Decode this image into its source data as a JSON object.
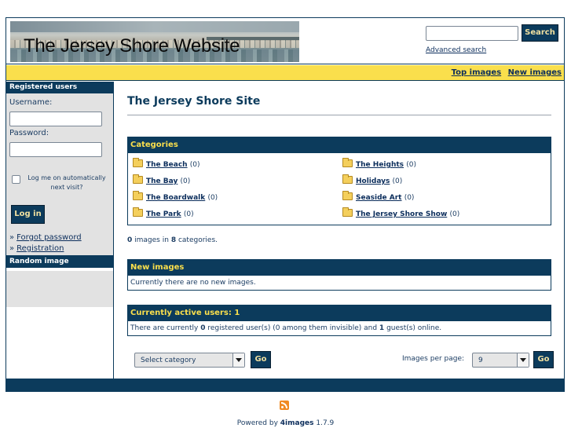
{
  "header": {
    "site_title": "The Jersey Shore Website",
    "search_button": "Search",
    "search_value": "",
    "advanced_search": "Advanced search"
  },
  "topbar": {
    "top_images": "Top images",
    "new_images": "New images"
  },
  "sidebar": {
    "registered_users_title": "Registered users",
    "username_label": "Username:",
    "password_label": "Password:",
    "auto_login_label": "Log me on automatically next visit?",
    "login_button": "Log in",
    "forgot_password": "Forgot password",
    "registration": "Registration",
    "link_marker": "»",
    "random_image_title": "Random image"
  },
  "main": {
    "page_title": "The Jersey Shore Site",
    "categories_title": "Categories",
    "categories": [
      {
        "name": "The Beach",
        "count": "(0)"
      },
      {
        "name": "The Heights",
        "count": "(0)"
      },
      {
        "name": "The Bay",
        "count": "(0)"
      },
      {
        "name": "Holidays",
        "count": "(0)"
      },
      {
        "name": "The Boardwalk",
        "count": "(0)"
      },
      {
        "name": "Seaside Art",
        "count": "(0)"
      },
      {
        "name": "The Park",
        "count": "(0)"
      },
      {
        "name": "The Jersey Shore Show",
        "count": "(0)"
      }
    ],
    "stats": {
      "images": "0",
      "images_text": "images in",
      "categories": "8",
      "categories_text": "categories."
    },
    "new_images_title": "New images",
    "new_images_text": "Currently there are no new images.",
    "active_users_title": "Currently active users: 1",
    "active_users_text": {
      "p1": "There are currently",
      "registered": "0",
      "p2": "registered user(s) (0 among them invisible) and",
      "guests": "1",
      "p3": "guest(s) online."
    },
    "select_category": "Select category",
    "go_label": "Go",
    "images_per_page_label": "Images per page:",
    "images_per_page_value": "9"
  },
  "footer": {
    "powered_prefix": "Powered by",
    "brand": "4images",
    "version": "1.7.9"
  },
  "colors": {
    "navy": "#0c3b5c",
    "yellow": "#fadf4c",
    "sidebar_gray": "#e2e2e2"
  }
}
